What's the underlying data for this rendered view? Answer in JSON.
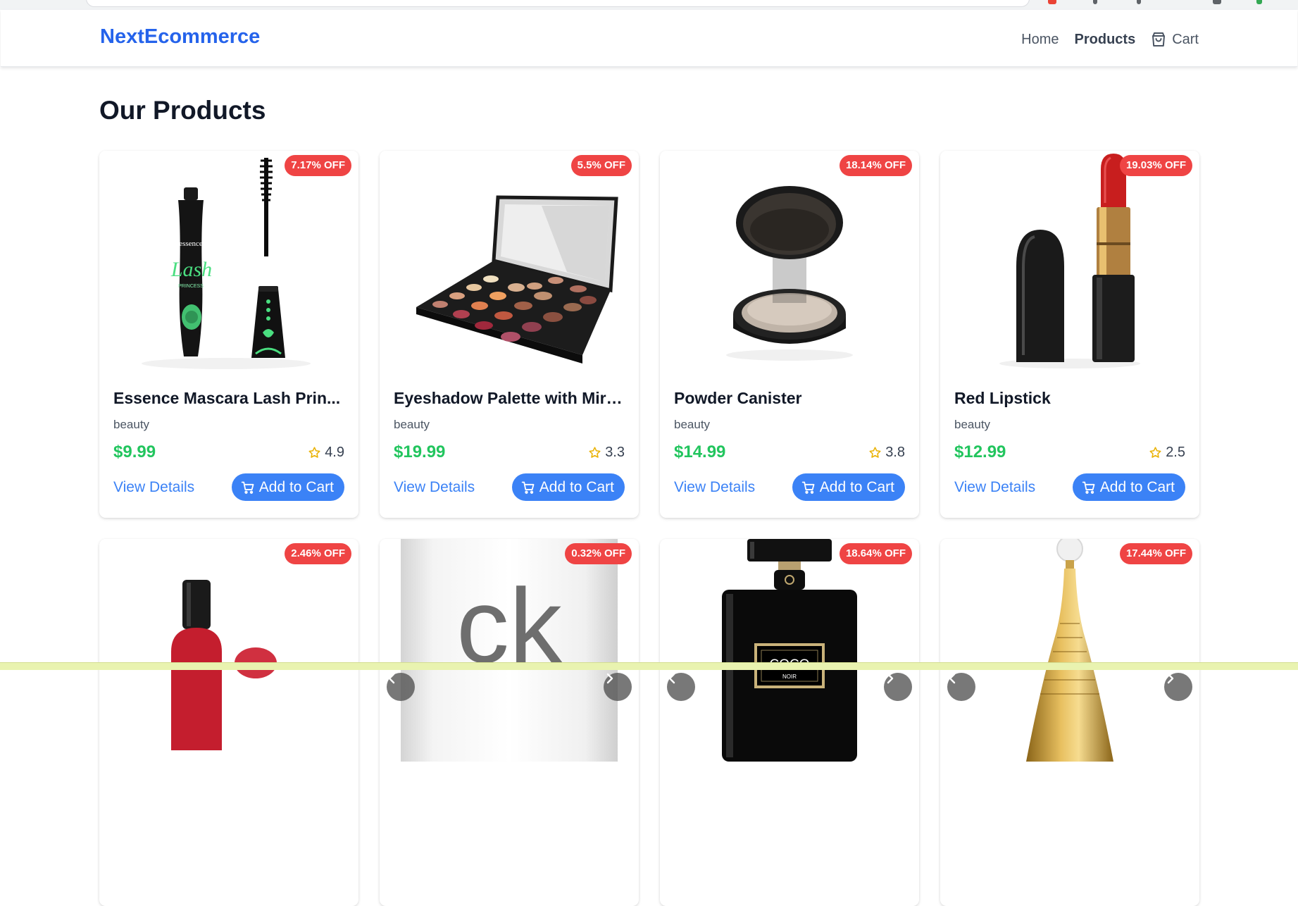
{
  "navbar": {
    "brand": "NextEcommerce",
    "links": {
      "home": "Home",
      "products": "Products",
      "cart": "Cart"
    }
  },
  "page": {
    "title": "Our Products"
  },
  "colors": {
    "brand": "#2563eb",
    "badge": "#ef4444",
    "price": "#22c55e",
    "button": "#3b82f6",
    "star": "#eab308"
  },
  "icons": {
    "cart_nav": "shopping-bag-icon",
    "cart_button": "cart-icon",
    "rating": "star-icon",
    "carousel_prev": "chevron-left-icon",
    "carousel_next": "chevron-right-icon"
  },
  "products": [
    {
      "badge": "7.17% OFF",
      "title": "Essence Mascara Lash Prin...",
      "category": "beauty",
      "price": "$9.99",
      "rating": "4.9",
      "view_label": "View Details",
      "cart_label": "Add to Cart"
    },
    {
      "badge": "5.5% OFF",
      "title": "Eyeshadow Palette with Mirror",
      "category": "beauty",
      "price": "$19.99",
      "rating": "3.3",
      "view_label": "View Details",
      "cart_label": "Add to Cart"
    },
    {
      "badge": "18.14% OFF",
      "title": "Powder Canister",
      "category": "beauty",
      "price": "$14.99",
      "rating": "3.8",
      "view_label": "View Details",
      "cart_label": "Add to Cart"
    },
    {
      "badge": "19.03% OFF",
      "title": "Red Lipstick",
      "category": "beauty",
      "price": "$12.99",
      "rating": "2.5",
      "view_label": "View Details",
      "cart_label": "Add to Cart"
    },
    {
      "badge": "2.46% OFF"
    },
    {
      "badge": "0.32% OFF",
      "image_text": "ck"
    },
    {
      "badge": "18.64% OFF",
      "image_text": "COCO",
      "image_subtext": "NOIR"
    },
    {
      "badge": "17.44% OFF"
    }
  ]
}
